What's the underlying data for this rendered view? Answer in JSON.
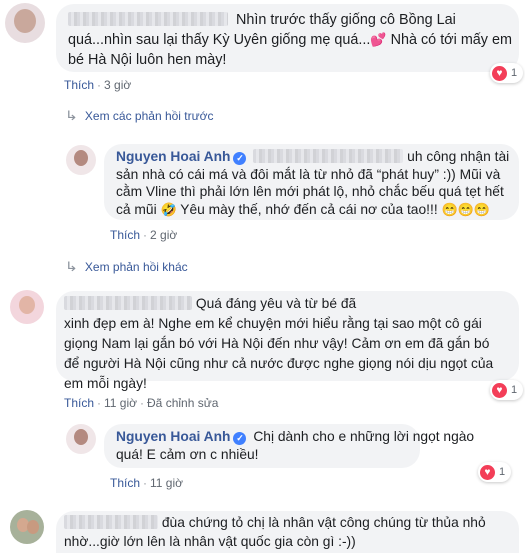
{
  "comments": [
    {
      "lines": [
        "Nhìn trước thấy giống cô Bồng Lai",
        "quá...nhìn sau lại thấy Kỳ Uyên giống mẹ quá...",
        "bé Hà Nội luôn hen mày!"
      ],
      "tail_1": "Nhà có tới mấy em",
      "emoji_heart": "💕",
      "like": "Thích",
      "time": "3 giờ",
      "reaction_count": "1"
    }
  ],
  "view_previous_replies": "Xem các phản hồi trước",
  "reply1": {
    "author": "Nguyen Hoai Anh",
    "lines": [
      "uh công nhận tài",
      "sản nhà có cái má và đôi mắt là từ nhỏ đã “phát huy” :)) Mũi và",
      "cằm Vline thì phải lớn lên mới phát lộ, nhỏ chắc bếu quá tẹt hết",
      "cả mũi",
      "Yêu mày thế, nhớ đến cả cái nơ của tao!!!"
    ],
    "emoji_grin": "🤣",
    "emoji_laugh": "😁😁😁",
    "like": "Thích",
    "time": "2 giờ"
  },
  "view_more_replies": "Xem phản hồi khác",
  "comment2": {
    "lines": [
      "Quá đáng yêu và từ bé đã",
      "xinh đẹp em à! Nghe em kể chuyện mới hiểu rằng tại sao một cô gái",
      "giọng Nam lại gắn bó với Hà Nội đến như vậy! Cảm ơn em đã gắn bó",
      "để người Hà Nội cũng như cả nước được nghe giọng nói dịu ngọt của",
      "em mỗi ngày!"
    ],
    "like": "Thích",
    "time": "11 giờ",
    "edited": "Đã chỉnh sửa",
    "reaction_count": "1"
  },
  "reply2": {
    "author": "Nguyen Hoai Anh",
    "lines": [
      "Chị dành cho e những lời ngọt ngào",
      "quá! E cảm ơn c nhiều!"
    ],
    "like": "Thích",
    "time": "11 giờ",
    "reaction_count": "1"
  },
  "comment3": {
    "lines": [
      "đùa chứng tỏ chị là nhân vật công chúng từ thủa nhỏ",
      "nhờ...giờ lớn lên là nhân vật quốc gia còn gì :-))"
    ]
  },
  "colors": {
    "link": "#385898",
    "bubble": "#f2f3f5",
    "heart": "#f33e58",
    "verified": "#4080ff"
  }
}
